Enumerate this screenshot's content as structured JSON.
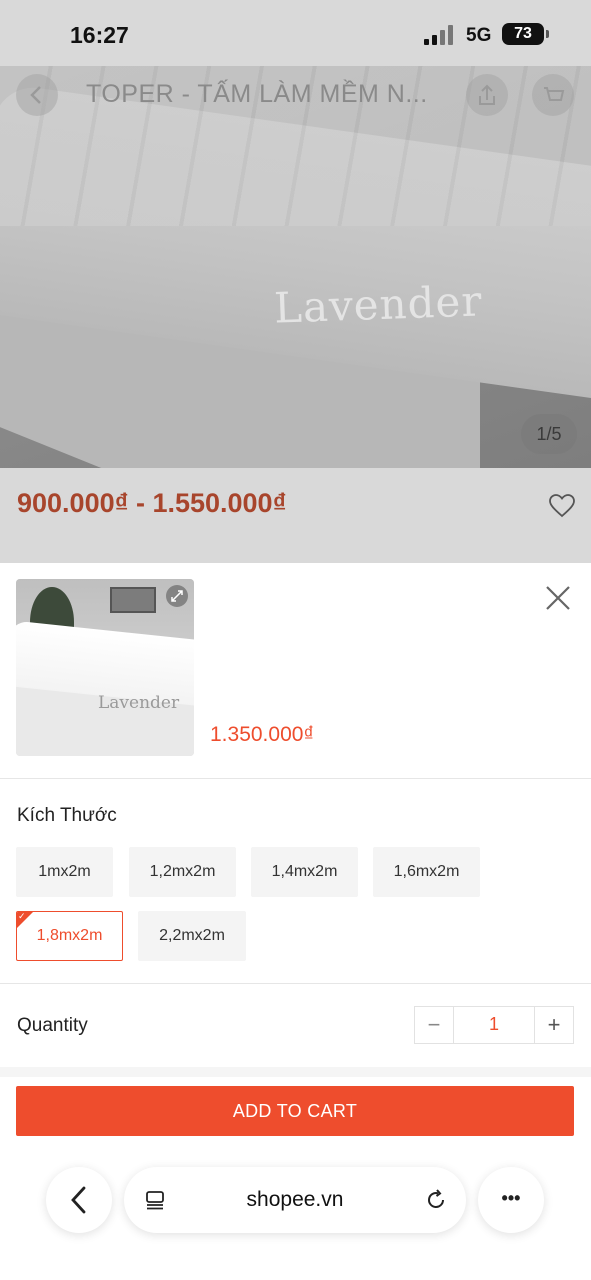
{
  "status_bar": {
    "time": "16:27",
    "network": "5G",
    "battery": "73"
  },
  "product": {
    "title": "TOPER - TẤM LÀM MỀM N...",
    "image_counter": "1/5",
    "watermark": "Lavender",
    "price_range": "900.000₫ - 1.550.000₫"
  },
  "sheet": {
    "thumb_watermark": "Lavender",
    "selected_price": "1.350.000₫",
    "variation_title": "Kích Thước",
    "options": [
      {
        "label": "1mx2m",
        "selected": false
      },
      {
        "label": "1,2mx2m",
        "selected": false
      },
      {
        "label": "1,4mx2m",
        "selected": false
      },
      {
        "label": "1,6mx2m",
        "selected": false
      },
      {
        "label": "1,8mx2m",
        "selected": true
      },
      {
        "label": "2,2mx2m",
        "selected": false
      }
    ],
    "quantity_label": "Quantity",
    "quantity_value": "1",
    "minus": "−",
    "plus": "+",
    "add_to_cart": "ADD TO CART"
  },
  "browser": {
    "url": "shopee.vn",
    "more": "•••"
  },
  "colors": {
    "accent": "#ee4d2d",
    "dim_price": "#a8452c"
  },
  "icons": [
    "back-icon",
    "share-icon",
    "cart-icon",
    "more-icon",
    "heart-icon",
    "expand-icon",
    "close-icon",
    "tabs-icon",
    "reload-icon"
  ]
}
